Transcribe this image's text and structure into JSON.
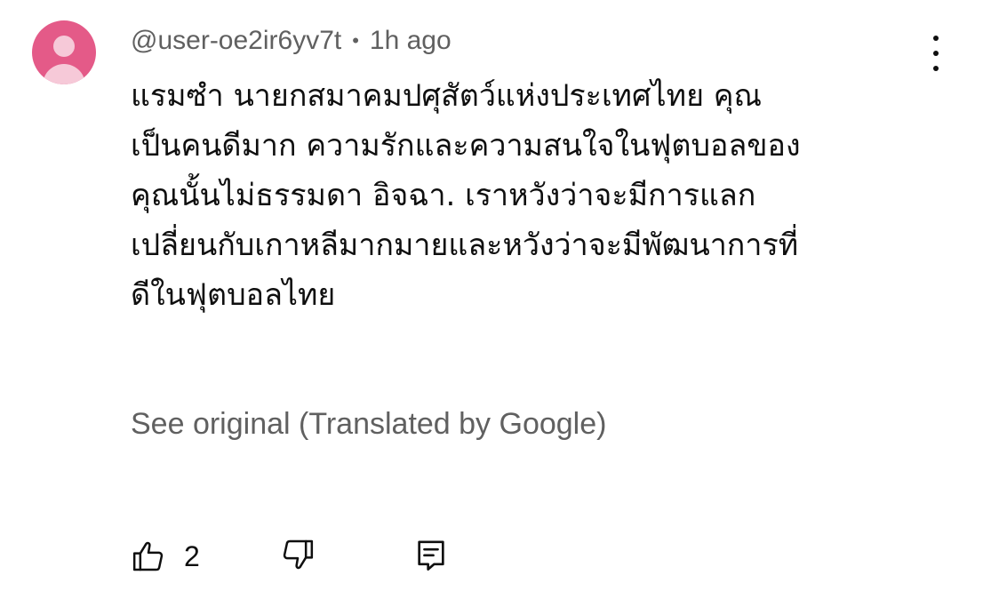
{
  "comment": {
    "author": "@user-oe2ir6yv7t",
    "separator": "•",
    "time": "1h ago",
    "text_lines": [
      "แรมซำ นายกสมาคมปศุสัตว์แห่งประเทศไทย คุณ",
      "เป็นคนดีมาก ความรักและความสนใจในฟุตบอลของ",
      "คุณนั้นไม่ธรรมดา อิจฉา. เราหวังว่าจะมีการแลก",
      "เปลี่ยนกับเกาหลีมากมายและหวังว่าจะมีพัฒนาการที่",
      "ดีในฟุตบอลไทย"
    ],
    "see_original": "See original (Translated by Google)",
    "like_count": "2"
  },
  "avatar": {
    "color": "#e45a88",
    "figure_color": "#f6c9d8"
  },
  "icons": {
    "menu": "more-vertical-icon",
    "like": "thumbs-up-icon",
    "dislike": "thumbs-down-icon",
    "reply": "reply-comment-icon"
  },
  "colors": {
    "primary_text": "#0f0f0f",
    "secondary_text": "#606060"
  }
}
